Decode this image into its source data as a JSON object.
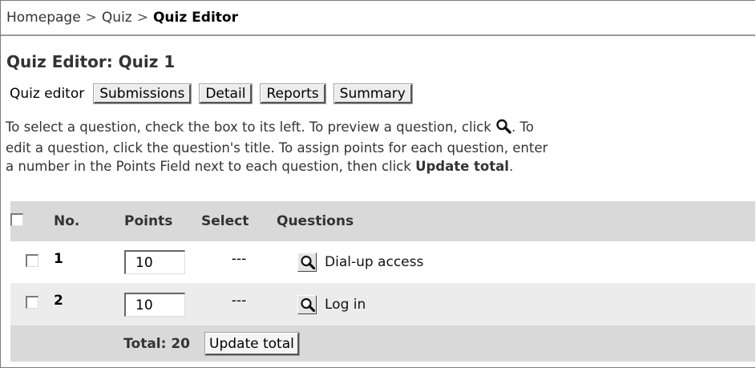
{
  "breadcrumb": {
    "items": [
      "Homepage",
      "Quiz"
    ],
    "separator": ">",
    "current": "Quiz Editor"
  },
  "page_title": "Quiz Editor: Quiz 1",
  "tabs": {
    "current": "Quiz editor",
    "buttons": [
      "Submissions",
      "Detail",
      "Reports",
      "Summary"
    ]
  },
  "instructions": {
    "part1": "To select a question, check the box to its left. To preview a question, click ",
    "part2": ". To",
    "line2": "edit a question, click the question's title. To assign points for each question, enter",
    "line3_start": "a number in the Points Field next to each question, then click ",
    "line3_bold": "Update total",
    "line3_end": "."
  },
  "table": {
    "headers": {
      "no": "No.",
      "points": "Points",
      "select": "Select",
      "questions": "Questions"
    },
    "rows": [
      {
        "no": "1",
        "points": "10",
        "select": "---",
        "title": "Dial-up access"
      },
      {
        "no": "2",
        "points": "10",
        "select": "---",
        "title": "Log in"
      }
    ],
    "total_label": "Total: 20",
    "update_button": "Update total"
  },
  "icons": {
    "preview": "magnifier-icon",
    "checkbox": "checkbox-icon"
  }
}
